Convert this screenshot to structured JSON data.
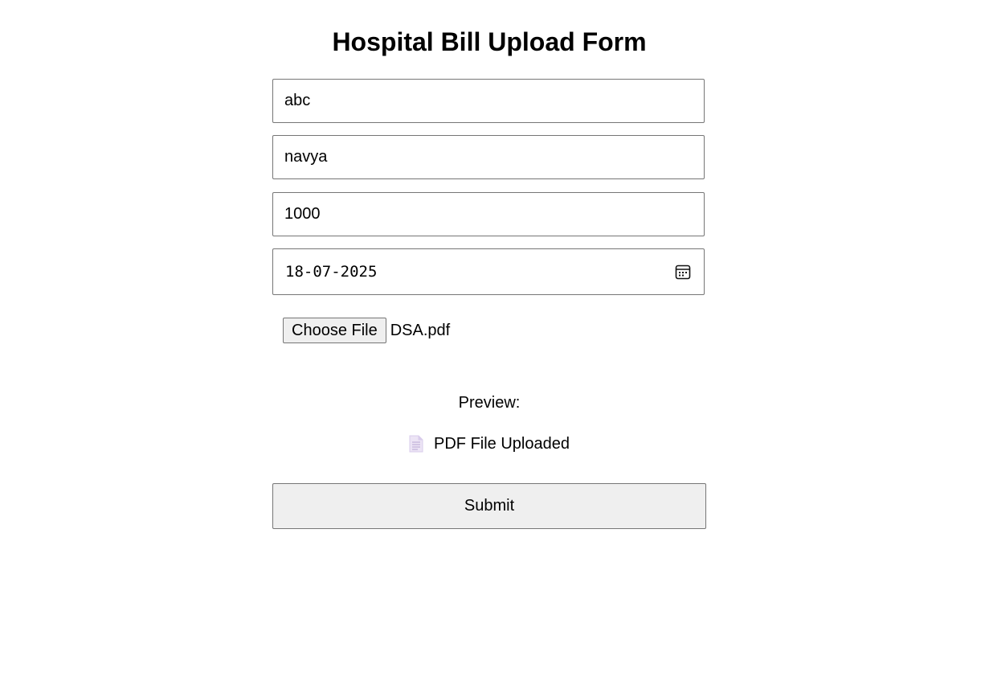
{
  "form": {
    "title": "Hospital Bill Upload Form",
    "hospital_name": "abc",
    "patient_name": "navya",
    "amount": "1000",
    "date": "18-07-2025",
    "file_button_label": "Choose File",
    "file_name": "DSA.pdf",
    "preview_label": "Preview:",
    "preview_text": "PDF File Uploaded",
    "submit_label": "Submit"
  },
  "icons": {
    "date_picker": "calendar-icon",
    "preview_file": "document-icon"
  }
}
